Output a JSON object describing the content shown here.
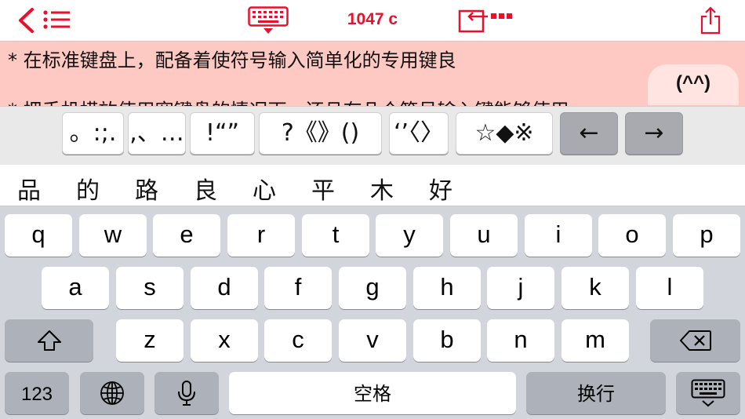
{
  "toolbar": {
    "char_count": "1047 c",
    "icons": [
      "back-chevron-icon",
      "list-icon",
      "keyboard-dismiss-icon",
      "insert-text-icon",
      "share-icon"
    ],
    "accent_color": "#e8112d"
  },
  "editor": {
    "lines": [
      "* 在标准键盘上，配备着使符号输入简单化的专用键良",
      "* 把手机横放使用宽键盘的情况下，还且有几个符号输入键能够使用"
    ],
    "emoticon_label": "(^^)",
    "background_color": "#ffc9c3"
  },
  "symbol_bar": {
    "keys": [
      "。:;.",
      ",、…",
      "!“”",
      "?《》()",
      "‘’〈〉",
      "☆◆※",
      "←",
      "→"
    ]
  },
  "candidates": [
    "品",
    "的",
    "路",
    "良",
    "心",
    "平",
    "木",
    "好"
  ],
  "keyboard": {
    "row1": [
      "q",
      "w",
      "e",
      "r",
      "t",
      "y",
      "u",
      "i",
      "o",
      "p"
    ],
    "row2": [
      "a",
      "s",
      "d",
      "f",
      "g",
      "h",
      "j",
      "k",
      "l"
    ],
    "row3": [
      "z",
      "x",
      "c",
      "v",
      "b",
      "n",
      "m"
    ],
    "numbers_label": "123",
    "space_label": "空格",
    "return_label": "换行",
    "icons": [
      "shift-icon",
      "delete-icon",
      "globe-icon",
      "microphone-icon",
      "keyboard-hide-icon"
    ]
  }
}
